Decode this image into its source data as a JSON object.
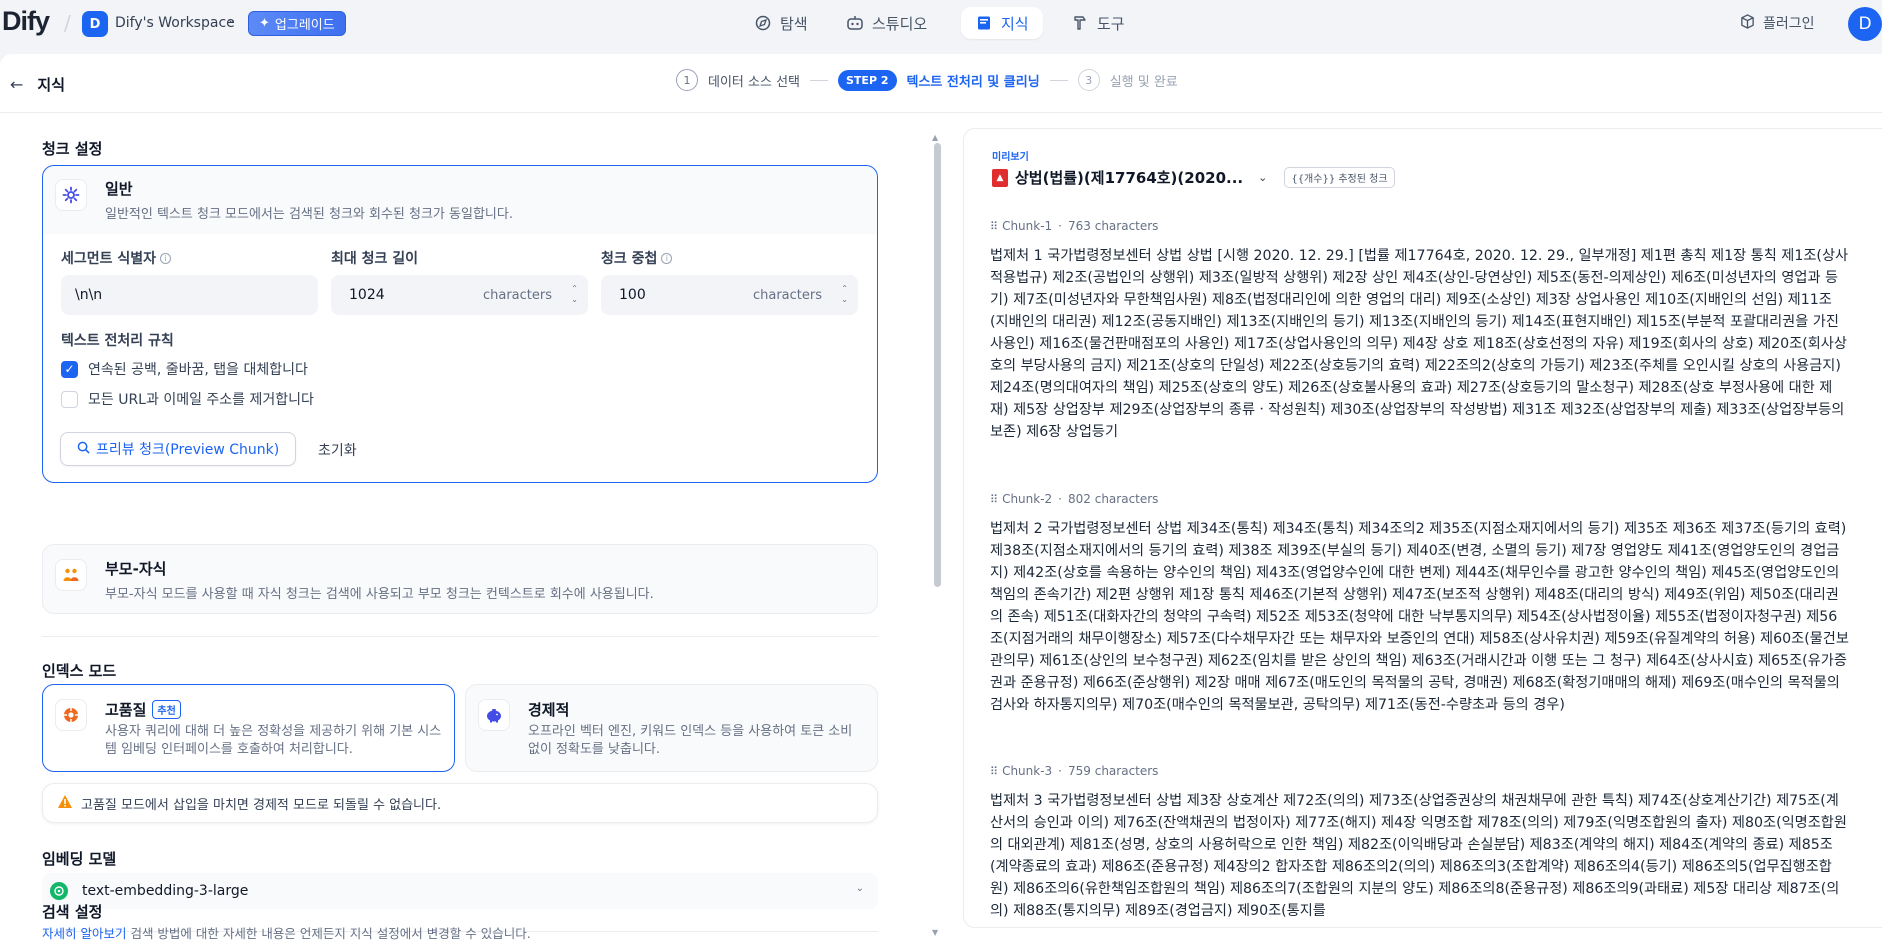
{
  "topbar": {
    "logo": "Dify",
    "workspace_initial": "D",
    "workspace_name": "Dify's Workspace",
    "upgrade_label": "업그레이드",
    "nav": {
      "explore": "탐색",
      "studio": "스튜디오",
      "knowledge": "지식",
      "tools": "도구"
    },
    "plugin_label": "플러그인",
    "user_initial": "D"
  },
  "header": {
    "back_label": "지식",
    "steps": [
      {
        "num": "1",
        "label": "데이터 소스 선택"
      },
      {
        "pill": "STEP 2",
        "label": "텍스트 전처리 및 클리닝"
      },
      {
        "num": "3",
        "label": "실행 및 완료"
      }
    ]
  },
  "chunk_settings": {
    "title": "청크 설정",
    "general": {
      "title": "일반",
      "desc": "일반적인 텍스트 청크 모드에서는 검색된 청크와 회수된 청크가 동일합니다."
    },
    "segment_label": "세그먼트 식별자",
    "segment_value": "\\n\\n",
    "max_len_label": "최대 청크 길이",
    "max_len_value": "1024",
    "overlap_label": "청크 중첩",
    "overlap_value": "100",
    "unit": "characters",
    "rules_label": "텍스트 전처리 규칙",
    "rule1": "연속된 공백, 줄바꿈, 탭을 대체합니다",
    "rule1_checked": true,
    "rule2": "모든 URL과 이메일 주소를 제거합니다",
    "rule2_checked": false,
    "preview_button": "프리뷰 청크(Preview Chunk)",
    "reset_button": "초기화",
    "parent_child": {
      "title": "부모-자식",
      "desc": "부모-자식 모드를 사용할 때 자식 청크는 검색에 사용되고 부모 청크는 컨텍스트로 회수에 사용됩니다."
    }
  },
  "index_mode": {
    "title": "인덱스 모드",
    "high": {
      "title": "고품질",
      "badge": "추천",
      "desc": "사용자 쿼리에 대해 더 높은 정확성을 제공하기 위해 기본 시스템 임베딩 인터페이스를 호출하여 처리합니다."
    },
    "eco": {
      "title": "경제적",
      "desc": "오프라인 벡터 엔진, 키워드 인덱스 등을 사용하여 토큰 소비 없이 정확도를 낮춥니다."
    },
    "warning": "고품질 모드에서 삽입을 마치면 경제적 모드로 되돌릴 수 없습니다."
  },
  "embedding": {
    "title": "임베딩 모델",
    "model": "text-embedding-3-large"
  },
  "retrieval": {
    "title": "검색 설정",
    "link": "자세히 알아보기",
    "desc": " 검색 방법에 대한 자세한 내용은 언제든지 지식 설정에서 변경할 수 있습니다."
  },
  "preview": {
    "label": "미리보기",
    "doc_name": "상법(법률)(제17764호)(2020...",
    "estimated": "{{개수}} 추정된 청크",
    "chunks": [
      {
        "name": "Chunk-1",
        "chars": "763 characters",
        "text": "법제처 1 국가법령정보센터 상법 상법 [시행 2020. 12. 29.] [법률 제17764호, 2020. 12. 29., 일부개정] 제1편 총칙 제1장 통칙 제1조(상사적용법규) 제2조(공법인의 상행위) 제3조(일방적 상행위) 제2장 상인 제4조(상인-당연상인) 제5조(동전-의제상인) 제6조(미성년자의 영업과 등기) 제7조(미성년자와 무한책임사원) 제8조(법정대리인에 의한 영업의 대리) 제9조(소상인) 제3장 상업사용인 제10조(지배인의 선임) 제11조(지배인의 대리권) 제12조(공동지배인) 제13조(지배인의 등기) 제13조(지배인의 등기) 제14조(표현지배인) 제15조(부분적 포괄대리권을 가진 사용인) 제16조(물건판매점포의 사용인) 제17조(상업사용인의 의무) 제4장 상호 제18조(상호선정의 자유) 제19조(회사의 상호) 제20조(회사상호의 부당사용의 금지) 제21조(상호의 단일성) 제22조(상호등기의 효력) 제22조의2(상호의 가등기) 제23조(주체를 오인시킬 상호의 사용금지) 제24조(명의대여자의 책임) 제25조(상호의 양도) 제26조(상호불사용의 효과) 제27조(상호등기의 말소청구) 제28조(상호 부정사용에 대한 제재) 제5장 상업장부 제29조(상업장부의 종류ㆍ작성원칙) 제30조(상업장부의 작성방법) 제31조 제32조(상업장부의 제출) 제33조(상업장부등의 보존) 제6장 상업등기"
      },
      {
        "name": "Chunk-2",
        "chars": "802 characters",
        "text": "법제처 2 국가법령정보센터 상법 제34조(통칙) 제34조(통칙) 제34조의2 제35조(지점소재지에서의 등기) 제35조 제36조 제37조(등기의 효력) 제38조(지점소재지에서의 등기의 효력) 제38조 제39조(부실의 등기) 제40조(변경, 소멸의 등기) 제7장 영업양도 제41조(영업양도인의 경업금지) 제42조(상호를 속용하는 양수인의 책임) 제43조(영업양수인에 대한 변제) 제44조(채무인수를 광고한 양수인의 책임) 제45조(영업양도인의 책임의 존속기간) 제2편 상행위 제1장 통칙 제46조(기본적 상행위) 제47조(보조적 상행위) 제48조(대리의 방식) 제49조(위임) 제50조(대리권의 존속) 제51조(대화자간의 청약의 구속력) 제52조 제53조(청약에 대한 낙부통지의무) 제54조(상사법정이율) 제55조(법정이자청구권) 제56조(지점거래의 채무이행장소) 제57조(다수채무자간 또는 채무자와 보증인의 연대) 제58조(상사유치권) 제59조(유질계약의 허용) 제60조(물건보관의무) 제61조(상인의 보수청구권) 제62조(임치를 받은 상인의 책임) 제63조(거래시간과 이행 또는 그 청구) 제64조(상사시효) 제65조(유가증권과 준용규정) 제66조(준상행위) 제2장 매매 제67조(매도인의 목적물의 공탁, 경매권) 제68조(확정기매매의 해제) 제69조(매수인의 목적물의 검사와 하자통지의무) 제70조(매수인의 목적물보관, 공탁의무) 제71조(동전-수량초과 등의 경우)"
      },
      {
        "name": "Chunk-3",
        "chars": "759 characters",
        "text": "법제처 3 국가법령정보센터 상법 제3장 상호계산 제72조(의의) 제73조(상업증권상의 채권채무에 관한 특칙) 제74조(상호계산기간) 제75조(계산서의 승인과 이의) 제76조(잔액채권의 법정이자) 제77조(해지) 제4장 익명조합 제78조(의의) 제79조(익명조합원의 출자) 제80조(익명조합원의 대외관계) 제81조(성명, 상호의 사용허락으로 인한 책임) 제82조(이익배당과 손실분담) 제83조(계약의 해지) 제84조(계약의 종료) 제85조(계약종료의 효과) 제86조(준용규정) 제4장의2 합자조합 제86조의2(의의) 제86조의3(조합계약) 제86조의4(등기) 제86조의5(업무집행조합원) 제86조의6(유한책임조합원의 책임) 제86조의7(조합원의 지분의 양도) 제86조의8(준용규정) 제86조의9(과태료) 제5장 대리상 제87조(의의) 제88조(통지의무) 제89조(경업금지) 제90조(통지를"
      }
    ]
  },
  "colors": {
    "accent": "#1c64f2",
    "warning": "#f79009"
  }
}
